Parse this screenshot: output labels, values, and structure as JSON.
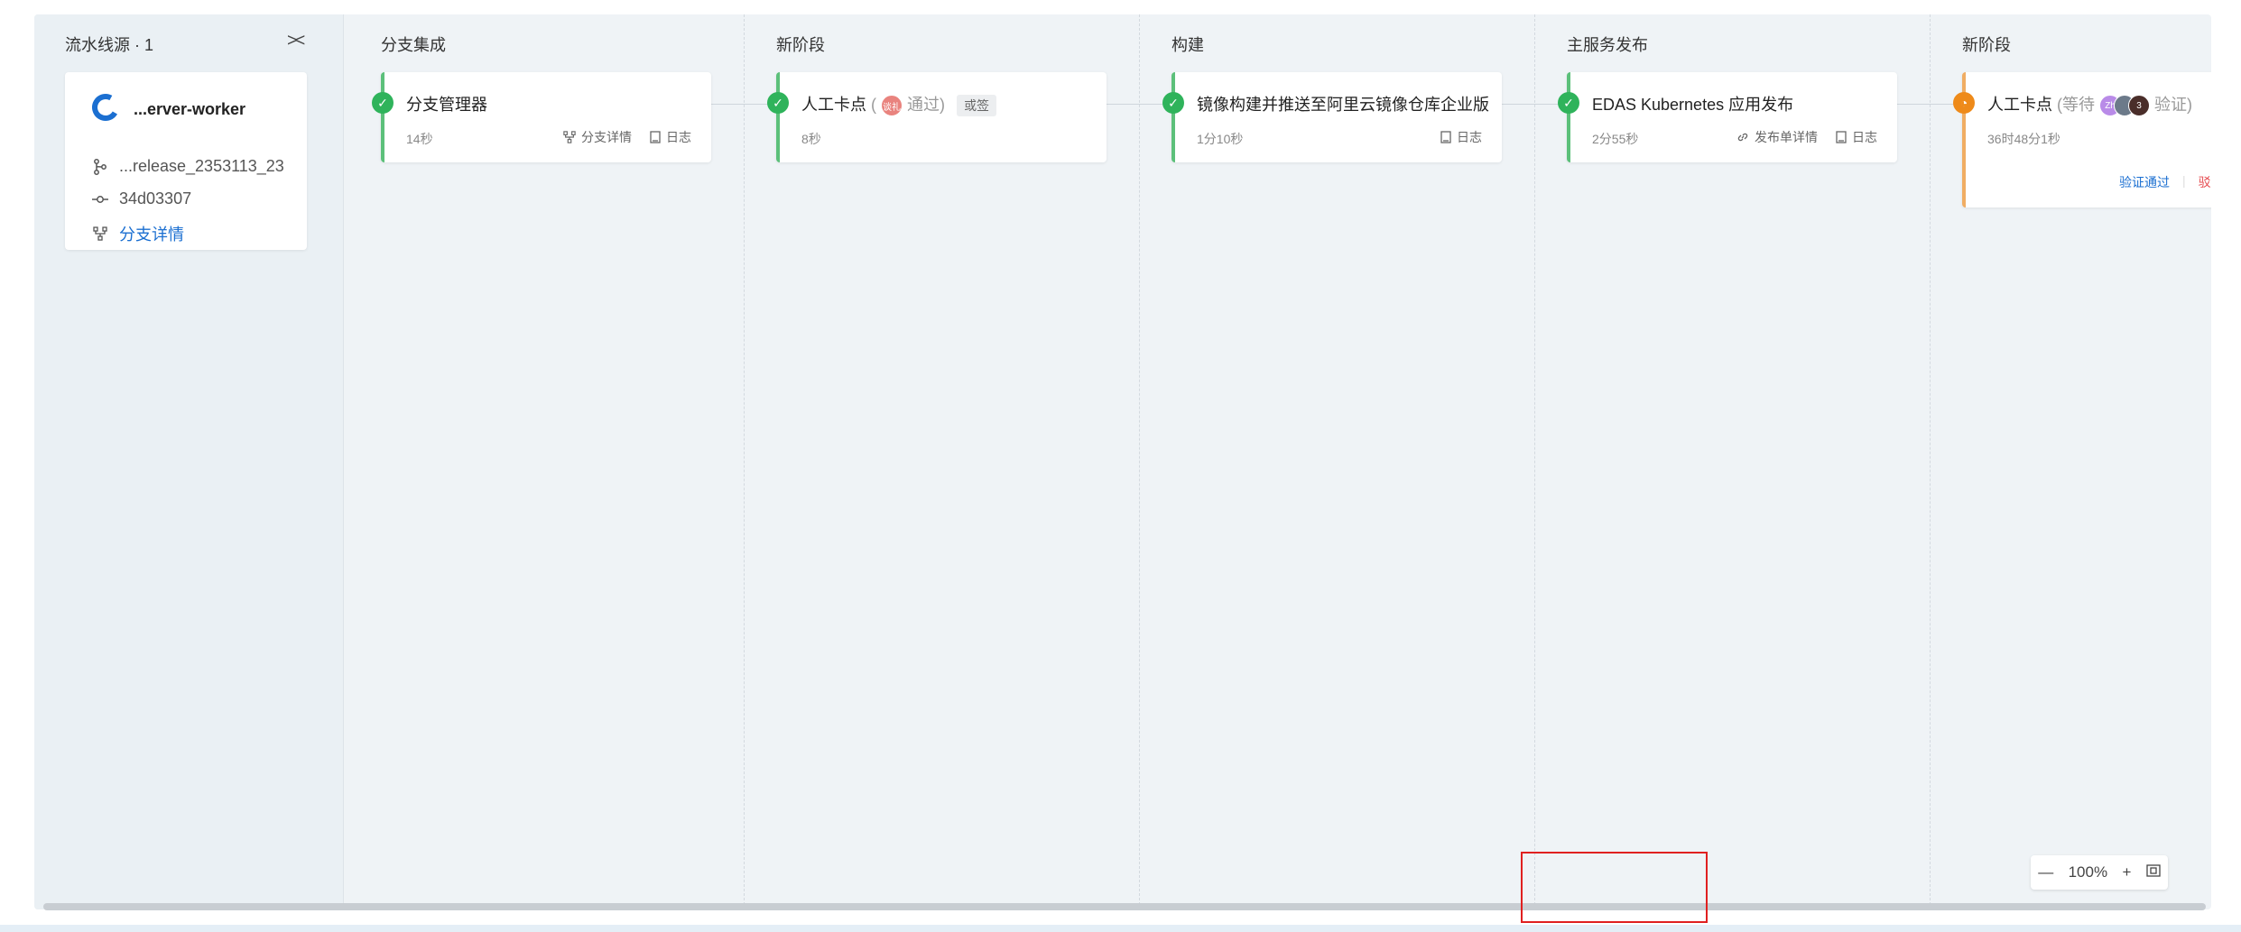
{
  "source": {
    "title": "流水线源 · 1",
    "collapse_icon": "><",
    "repo_name": "...erver-worker",
    "branch": "...release_2353113_23",
    "commit": "34d03307",
    "branch_detail": "分支详情"
  },
  "stages": [
    {
      "title": "分支集成",
      "job": {
        "name": "分支管理器",
        "time": "14秒",
        "actions": [
          "分支详情",
          "日志"
        ]
      }
    },
    {
      "title": "新阶段",
      "job": {
        "name": "人工卡点",
        "paren_open": "(",
        "avatar_text": "谈礼",
        "result": "通过)",
        "tag": "或签",
        "time": "8秒"
      }
    },
    {
      "title": "构建",
      "job": {
        "name": "镜像构建并推送至阿里云镜像仓库企业版",
        "time": "1分10秒",
        "actions": [
          "日志"
        ]
      }
    },
    {
      "title": "主服务发布",
      "job": {
        "name": "EDAS Kubernetes 应用发布",
        "time": "2分55秒",
        "actions": [
          "发布单详情",
          "日志"
        ]
      }
    },
    {
      "title": "新阶段",
      "job": {
        "name": "人工卡点",
        "wait_text": "(等待",
        "avatars": [
          "Zh",
          "",
          "3"
        ],
        "verify_text": "验证)",
        "time": "36时48分1秒",
        "approve": "验证通过",
        "reject": "驳"
      }
    }
  ],
  "zoom": {
    "minus": "—",
    "level": "100%",
    "plus": "+",
    "fit_icon": "fit-screen"
  },
  "colors": {
    "success": "#2fb35b",
    "pending": "#ee8a1a",
    "link": "#1b6fd1",
    "reject": "#e5484d"
  }
}
